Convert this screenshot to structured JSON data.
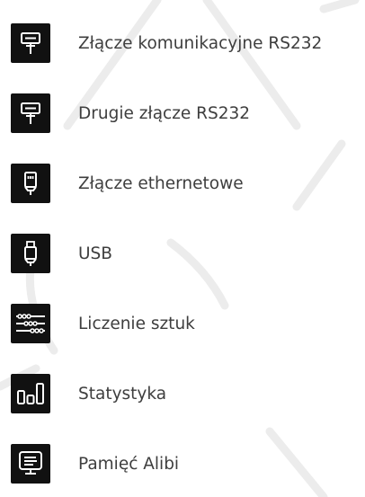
{
  "menu": {
    "items": [
      {
        "label": "Złącze komunikacyjne RS232",
        "icon": "rs232-connector-icon"
      },
      {
        "label": "Drugie złącze RS232",
        "icon": "rs232-connector-icon"
      },
      {
        "label": "Złącze ethernetowe",
        "icon": "ethernet-connector-icon"
      },
      {
        "label": "USB",
        "icon": "usb-connector-icon"
      },
      {
        "label": "Liczenie sztuk",
        "icon": "counting-sliders-icon"
      },
      {
        "label": "Statystyka",
        "icon": "statistics-bars-icon"
      },
      {
        "label": "Pamięć Alibi",
        "icon": "alibi-memory-monitor-icon"
      }
    ]
  },
  "colors": {
    "tile_background": "#111111",
    "icon_foreground": "#ffffff",
    "label_text": "#3e3e3e",
    "watermark": "#e9e9e9"
  }
}
